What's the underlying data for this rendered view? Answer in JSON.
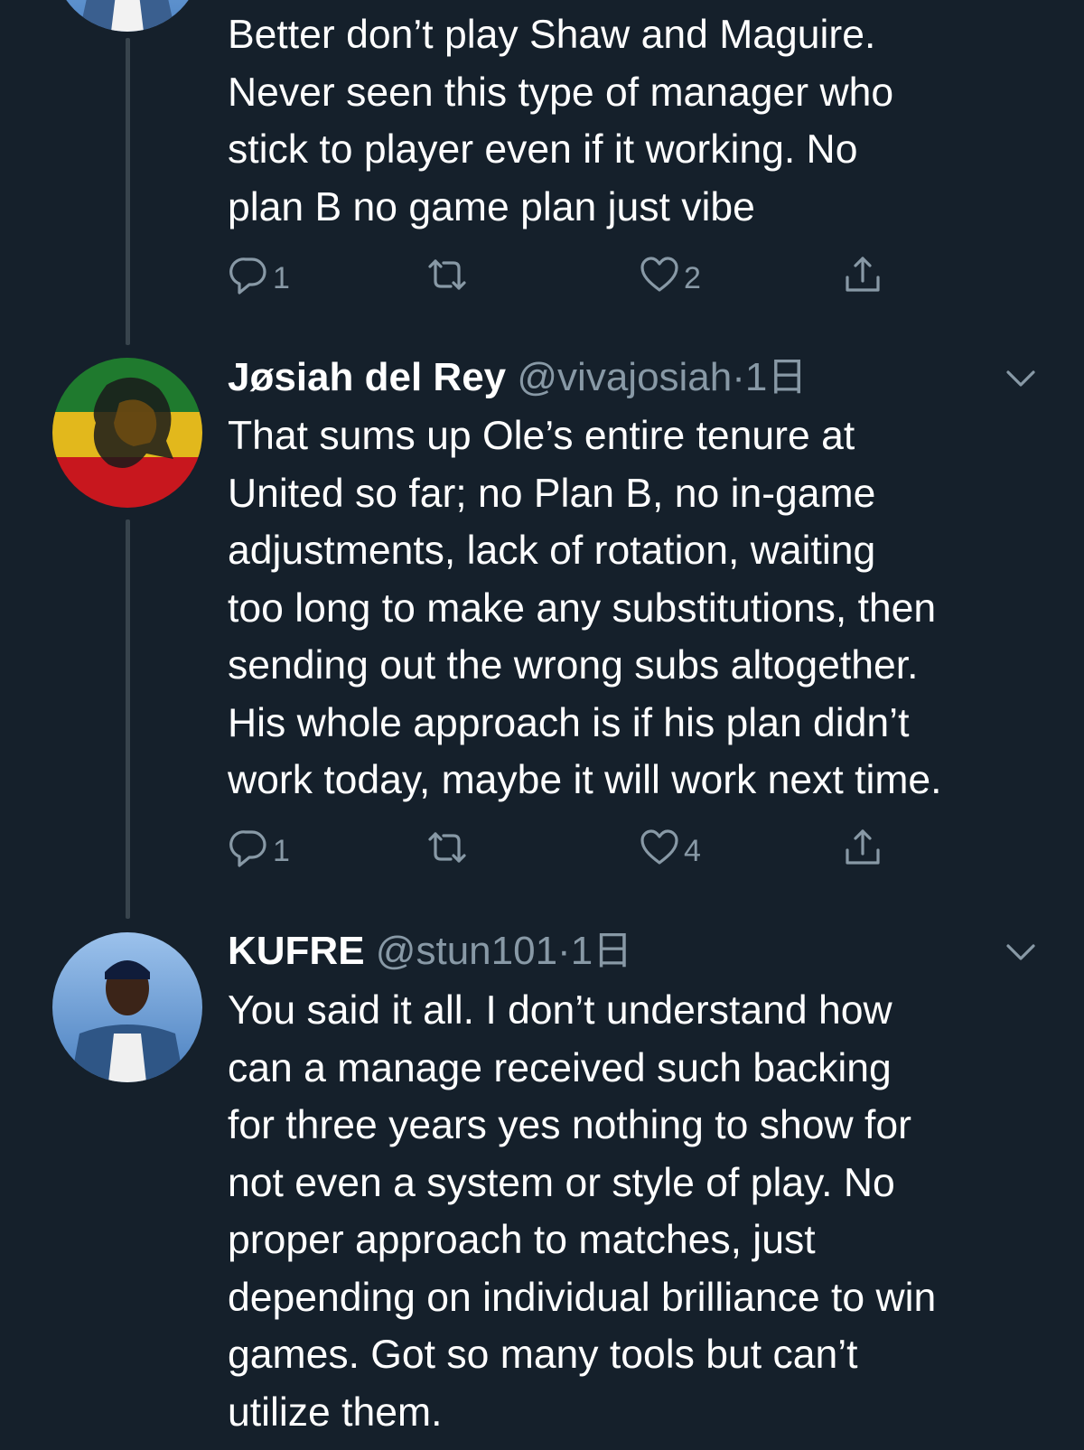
{
  "tweets": [
    {
      "text_lines": [
        "Better don’t play Shaw and Maguire.",
        "Never seen this type of manager who",
        "stick to player even if it working. No",
        "plan B no game plan just vibe"
      ],
      "reply_count": "1",
      "like_count": "2"
    },
    {
      "name": "Jøsiah del Rey",
      "handle": "@vivajosiah",
      "separator": "·",
      "time": "1日",
      "text_lines": [
        "That sums up Ole’s entire tenure at",
        "United so far; no Plan B, no in-game",
        "adjustments, lack of rotation, waiting",
        "too long to make any substitutions, then",
        "sending out the wrong subs altogether.",
        "His whole approach is if his plan didn’t",
        "work today, maybe it will work next time."
      ],
      "reply_count": "1",
      "like_count": "4"
    },
    {
      "name": "KUFRE",
      "handle": "@stun101",
      "separator": "·",
      "time": "1日",
      "text_lines": [
        "You said it all. I don’t understand how",
        "can a manage received such backing",
        "for three years yes nothing to show for",
        "not even a system or style of play. No",
        "proper approach to matches, just",
        "depending on individual brilliance to win",
        "games. Got so many tools but can’t",
        "utilize them."
      ]
    }
  ],
  "colors": {
    "background": "#15202b",
    "text": "#ffffff",
    "secondary": "#8899a6",
    "thread_line": "#38444d"
  },
  "icons": [
    "reply-icon",
    "retweet-icon",
    "like-icon",
    "share-icon",
    "chevron-down-icon"
  ]
}
